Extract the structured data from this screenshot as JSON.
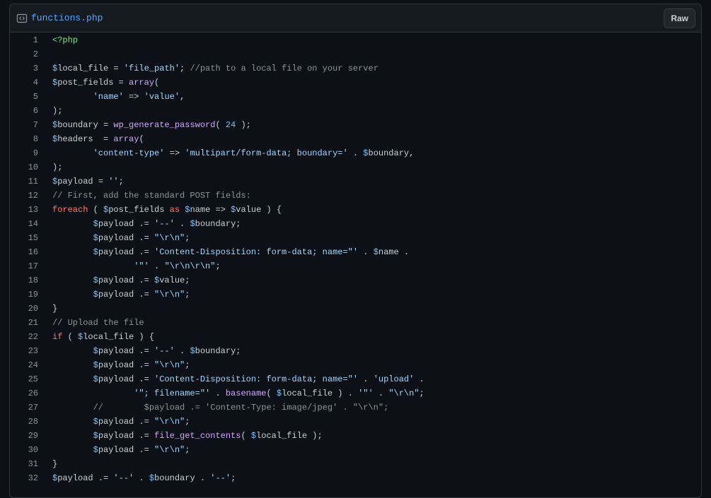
{
  "file": {
    "name": "functions.php",
    "raw_label": "Raw",
    "icon": "code-file-icon"
  },
  "colors": {
    "background": "#0d1117",
    "header_bg": "#161b22",
    "border": "#30363d",
    "link": "#58a6ff",
    "text": "#c9d1d9",
    "string": "#a5d6ff",
    "comment": "#8b949e",
    "keyword": "#ff7b72",
    "function": "#d2a8ff",
    "number": "#79c0ff",
    "tag": "#7ee787"
  },
  "code": {
    "lines": [
      {
        "n": "1",
        "tokens": [
          {
            "t": "<?php",
            "c": "tag"
          }
        ]
      },
      {
        "n": "2",
        "tokens": []
      },
      {
        "n": "3",
        "tokens": [
          {
            "t": "$",
            "c": "v"
          },
          {
            "t": "local_file = ",
            "c": "t"
          },
          {
            "t": "'file_path'",
            "c": "s"
          },
          {
            "t": "; ",
            "c": "t"
          },
          {
            "t": "//path to a local file on your server",
            "c": "c"
          }
        ]
      },
      {
        "n": "4",
        "tokens": [
          {
            "t": "$",
            "c": "v"
          },
          {
            "t": "post_fields = ",
            "c": "t"
          },
          {
            "t": "array",
            "c": "f"
          },
          {
            "t": "(",
            "c": "t"
          }
        ]
      },
      {
        "n": "5",
        "tokens": [
          {
            "t": "        ",
            "c": "t"
          },
          {
            "t": "'name'",
            "c": "s"
          },
          {
            "t": " => ",
            "c": "t"
          },
          {
            "t": "'value'",
            "c": "s"
          },
          {
            "t": ",",
            "c": "t"
          }
        ]
      },
      {
        "n": "6",
        "tokens": [
          {
            "t": ");",
            "c": "t"
          }
        ]
      },
      {
        "n": "7",
        "tokens": [
          {
            "t": "$",
            "c": "v"
          },
          {
            "t": "boundary = ",
            "c": "t"
          },
          {
            "t": "wp_generate_password",
            "c": "f"
          },
          {
            "t": "( ",
            "c": "t"
          },
          {
            "t": "24",
            "c": "n"
          },
          {
            "t": " );",
            "c": "t"
          }
        ]
      },
      {
        "n": "8",
        "tokens": [
          {
            "t": "$",
            "c": "v"
          },
          {
            "t": "headers  = ",
            "c": "t"
          },
          {
            "t": "array",
            "c": "f"
          },
          {
            "t": "(",
            "c": "t"
          }
        ]
      },
      {
        "n": "9",
        "tokens": [
          {
            "t": "        ",
            "c": "t"
          },
          {
            "t": "'content-type'",
            "c": "s"
          },
          {
            "t": " => ",
            "c": "t"
          },
          {
            "t": "'multipart/form-data; boundary='",
            "c": "s"
          },
          {
            "t": " . ",
            "c": "t"
          },
          {
            "t": "$",
            "c": "v"
          },
          {
            "t": "boundary,",
            "c": "t"
          }
        ]
      },
      {
        "n": "10",
        "tokens": [
          {
            "t": ");",
            "c": "t"
          }
        ]
      },
      {
        "n": "11",
        "tokens": [
          {
            "t": "$",
            "c": "v"
          },
          {
            "t": "payload = ",
            "c": "t"
          },
          {
            "t": "''",
            "c": "s"
          },
          {
            "t": ";",
            "c": "t"
          }
        ]
      },
      {
        "n": "12",
        "tokens": [
          {
            "t": "// First, add the standard POST fields:",
            "c": "c"
          }
        ]
      },
      {
        "n": "13",
        "tokens": [
          {
            "t": "foreach",
            "c": "k"
          },
          {
            "t": " ( ",
            "c": "t"
          },
          {
            "t": "$",
            "c": "v"
          },
          {
            "t": "post_fields ",
            "c": "t"
          },
          {
            "t": "as",
            "c": "k"
          },
          {
            "t": " ",
            "c": "t"
          },
          {
            "t": "$",
            "c": "v"
          },
          {
            "t": "name => ",
            "c": "t"
          },
          {
            "t": "$",
            "c": "v"
          },
          {
            "t": "value ) {",
            "c": "t"
          }
        ]
      },
      {
        "n": "14",
        "tokens": [
          {
            "t": "        ",
            "c": "t"
          },
          {
            "t": "$",
            "c": "v"
          },
          {
            "t": "payload .= ",
            "c": "t"
          },
          {
            "t": "'--'",
            "c": "s"
          },
          {
            "t": " . ",
            "c": "t"
          },
          {
            "t": "$",
            "c": "v"
          },
          {
            "t": "boundary;",
            "c": "t"
          }
        ]
      },
      {
        "n": "15",
        "tokens": [
          {
            "t": "        ",
            "c": "t"
          },
          {
            "t": "$",
            "c": "v"
          },
          {
            "t": "payload .= ",
            "c": "t"
          },
          {
            "t": "\"\\r\\n\"",
            "c": "s"
          },
          {
            "t": ";",
            "c": "t"
          }
        ]
      },
      {
        "n": "16",
        "tokens": [
          {
            "t": "        ",
            "c": "t"
          },
          {
            "t": "$",
            "c": "v"
          },
          {
            "t": "payload .= ",
            "c": "t"
          },
          {
            "t": "'Content-Disposition: form-data; name=\"'",
            "c": "s"
          },
          {
            "t": " . ",
            "c": "t"
          },
          {
            "t": "$",
            "c": "v"
          },
          {
            "t": "name .",
            "c": "t"
          }
        ]
      },
      {
        "n": "17",
        "tokens": [
          {
            "t": "                ",
            "c": "t"
          },
          {
            "t": "'\"'",
            "c": "s"
          },
          {
            "t": " . ",
            "c": "t"
          },
          {
            "t": "\"\\r\\n\\r\\n\"",
            "c": "s"
          },
          {
            "t": ";",
            "c": "t"
          }
        ]
      },
      {
        "n": "18",
        "tokens": [
          {
            "t": "        ",
            "c": "t"
          },
          {
            "t": "$",
            "c": "v"
          },
          {
            "t": "payload .= ",
            "c": "t"
          },
          {
            "t": "$",
            "c": "v"
          },
          {
            "t": "value;",
            "c": "t"
          }
        ]
      },
      {
        "n": "19",
        "tokens": [
          {
            "t": "        ",
            "c": "t"
          },
          {
            "t": "$",
            "c": "v"
          },
          {
            "t": "payload .= ",
            "c": "t"
          },
          {
            "t": "\"\\r\\n\"",
            "c": "s"
          },
          {
            "t": ";",
            "c": "t"
          }
        ]
      },
      {
        "n": "20",
        "tokens": [
          {
            "t": "}",
            "c": "t"
          }
        ]
      },
      {
        "n": "21",
        "tokens": [
          {
            "t": "// Upload the file",
            "c": "c"
          }
        ]
      },
      {
        "n": "22",
        "tokens": [
          {
            "t": "if",
            "c": "k"
          },
          {
            "t": " ( ",
            "c": "t"
          },
          {
            "t": "$",
            "c": "v"
          },
          {
            "t": "local_file ) {",
            "c": "t"
          }
        ]
      },
      {
        "n": "23",
        "tokens": [
          {
            "t": "        ",
            "c": "t"
          },
          {
            "t": "$",
            "c": "v"
          },
          {
            "t": "payload .= ",
            "c": "t"
          },
          {
            "t": "'--'",
            "c": "s"
          },
          {
            "t": " . ",
            "c": "t"
          },
          {
            "t": "$",
            "c": "v"
          },
          {
            "t": "boundary;",
            "c": "t"
          }
        ]
      },
      {
        "n": "24",
        "tokens": [
          {
            "t": "        ",
            "c": "t"
          },
          {
            "t": "$",
            "c": "v"
          },
          {
            "t": "payload .= ",
            "c": "t"
          },
          {
            "t": "\"\\r\\n\"",
            "c": "s"
          },
          {
            "t": ";",
            "c": "t"
          }
        ]
      },
      {
        "n": "25",
        "tokens": [
          {
            "t": "        ",
            "c": "t"
          },
          {
            "t": "$",
            "c": "v"
          },
          {
            "t": "payload .= ",
            "c": "t"
          },
          {
            "t": "'Content-Disposition: form-data; name=\"'",
            "c": "s"
          },
          {
            "t": " . ",
            "c": "t"
          },
          {
            "t": "'upload'",
            "c": "s"
          },
          {
            "t": " .",
            "c": "t"
          }
        ]
      },
      {
        "n": "26",
        "tokens": [
          {
            "t": "                ",
            "c": "t"
          },
          {
            "t": "'\"; filename=\"'",
            "c": "s"
          },
          {
            "t": " . ",
            "c": "t"
          },
          {
            "t": "basename",
            "c": "f"
          },
          {
            "t": "( ",
            "c": "t"
          },
          {
            "t": "$",
            "c": "v"
          },
          {
            "t": "local_file ) . ",
            "c": "t"
          },
          {
            "t": "'\"'",
            "c": "s"
          },
          {
            "t": " . ",
            "c": "t"
          },
          {
            "t": "\"\\r\\n\"",
            "c": "s"
          },
          {
            "t": ";",
            "c": "t"
          }
        ]
      },
      {
        "n": "27",
        "tokens": [
          {
            "t": "        ",
            "c": "t"
          },
          {
            "t": "//        $payload .= 'Content-Type: image/jpeg' . \"\\r\\n\";",
            "c": "c"
          }
        ]
      },
      {
        "n": "28",
        "tokens": [
          {
            "t": "        ",
            "c": "t"
          },
          {
            "t": "$",
            "c": "v"
          },
          {
            "t": "payload .= ",
            "c": "t"
          },
          {
            "t": "\"\\r\\n\"",
            "c": "s"
          },
          {
            "t": ";",
            "c": "t"
          }
        ]
      },
      {
        "n": "29",
        "tokens": [
          {
            "t": "        ",
            "c": "t"
          },
          {
            "t": "$",
            "c": "v"
          },
          {
            "t": "payload .= ",
            "c": "t"
          },
          {
            "t": "file_get_contents",
            "c": "f"
          },
          {
            "t": "( ",
            "c": "t"
          },
          {
            "t": "$",
            "c": "v"
          },
          {
            "t": "local_file );",
            "c": "t"
          }
        ]
      },
      {
        "n": "30",
        "tokens": [
          {
            "t": "        ",
            "c": "t"
          },
          {
            "t": "$",
            "c": "v"
          },
          {
            "t": "payload .= ",
            "c": "t"
          },
          {
            "t": "\"\\r\\n\"",
            "c": "s"
          },
          {
            "t": ";",
            "c": "t"
          }
        ]
      },
      {
        "n": "31",
        "tokens": [
          {
            "t": "}",
            "c": "t"
          }
        ]
      },
      {
        "n": "32",
        "tokens": [
          {
            "t": "$",
            "c": "v"
          },
          {
            "t": "payload .= ",
            "c": "t"
          },
          {
            "t": "'--'",
            "c": "s"
          },
          {
            "t": " . ",
            "c": "t"
          },
          {
            "t": "$",
            "c": "v"
          },
          {
            "t": "boundary . ",
            "c": "t"
          },
          {
            "t": "'--'",
            "c": "s"
          },
          {
            "t": ";",
            "c": "t"
          }
        ]
      }
    ]
  }
}
